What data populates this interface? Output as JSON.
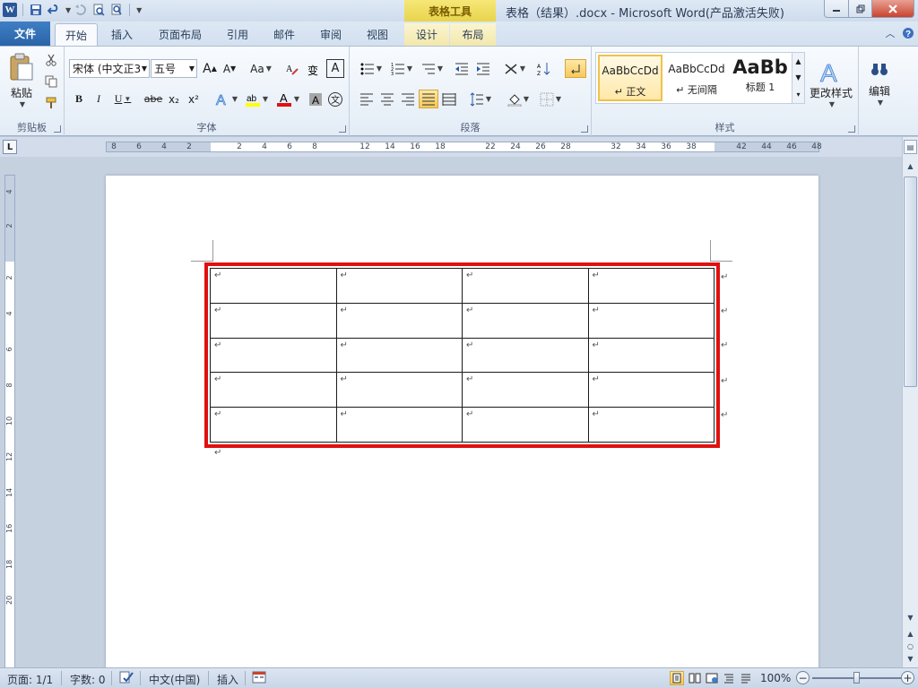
{
  "app": {
    "window_title": "表格（结果）.docx  -  Microsoft Word(产品激活失败)",
    "context_tab_group": "表格工具"
  },
  "quick_access": {
    "icons": [
      "word-app-icon",
      "save-icon",
      "undo-icon",
      "redo-icon",
      "print-preview-icon",
      "quick-print-icon",
      "customize-qat-icon"
    ]
  },
  "tabs": [
    {
      "label": "文件"
    },
    {
      "label": "开始"
    },
    {
      "label": "插入"
    },
    {
      "label": "页面布局"
    },
    {
      "label": "引用"
    },
    {
      "label": "邮件"
    },
    {
      "label": "审阅"
    },
    {
      "label": "视图"
    },
    {
      "label": "设计"
    },
    {
      "label": "布局"
    }
  ],
  "ribbon": {
    "clipboard": {
      "label": "剪贴板",
      "paste_label": "粘贴"
    },
    "font": {
      "label": "字体",
      "font_name": "宋体 (中文正3",
      "font_size": "五号",
      "bold": "B",
      "italic": "I",
      "underline": "U",
      "strike": "abe",
      "subscript": "x₂",
      "superscript": "x²",
      "grow": "A",
      "shrink": "A",
      "change_case": "Aa",
      "char_border": "A",
      "phonetic": "文"
    },
    "paragraph": {
      "label": "段落"
    },
    "styles": {
      "label": "样式",
      "items": [
        {
          "sample": "AaBbCcDd",
          "name": "↵ 正文"
        },
        {
          "sample": "AaBbCcDd",
          "name": "↵ 无间隔"
        },
        {
          "sample": "AaBb",
          "name": "标题 1"
        }
      ],
      "change_styles": "更改样式"
    },
    "editing": {
      "label": "编辑"
    }
  },
  "ruler": {
    "h_labels": [
      "8",
      "6",
      "4",
      "2",
      "2",
      "4",
      "6",
      "8",
      "12",
      "14",
      "16",
      "18",
      "22",
      "24",
      "26",
      "28",
      "32",
      "34",
      "36",
      "38",
      "42",
      "44",
      "46",
      "48"
    ],
    "v_labels": [
      "4",
      "2",
      "2",
      "4",
      "6",
      "8",
      "10",
      "12",
      "14",
      "16",
      "18",
      "20"
    ]
  },
  "document": {
    "table": {
      "rows": 5,
      "cols": 4,
      "cell_mark": "↵"
    },
    "para_mark": "↵"
  },
  "statusbar": {
    "page": "页面: 1/1",
    "words": "字数: 0",
    "language": "中文(中国)",
    "mode": "插入",
    "zoom": "100%"
  }
}
